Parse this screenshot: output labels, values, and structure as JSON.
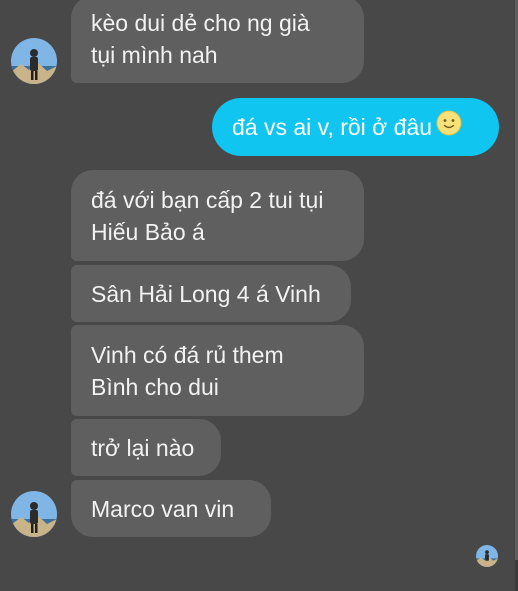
{
  "messages": [
    {
      "direction": "incoming",
      "lines": [
        "kèo dui dẻ cho ng già",
        "tụi mình nah"
      ]
    },
    {
      "direction": "outgoing",
      "text": "đá vs ai v, rồi ở đâu",
      "emoji": "slightly-smiling-face"
    },
    {
      "direction": "incoming",
      "lines": [
        "đá với bạn cấp 2 tui tụi",
        "Hiếu Bảo á"
      ]
    },
    {
      "direction": "incoming",
      "lines": [
        "Sân Hải Long 4 á Vinh"
      ]
    },
    {
      "direction": "incoming",
      "lines": [
        "Vinh có đá rủ them",
        "Bình cho dui"
      ]
    },
    {
      "direction": "incoming",
      "lines": [
        "trở lại nào"
      ]
    },
    {
      "direction": "incoming",
      "lines": [
        "Marco van vin"
      ]
    }
  ],
  "avatar_icon": "contact-avatar-photo",
  "seen_indicator_icon": "seen-avatar-photo",
  "colors": {
    "background": "#484848",
    "incoming_bubble": "#5f5f5f",
    "outgoing_bubble": "#10c5f0",
    "text": "#f2f2f2"
  }
}
